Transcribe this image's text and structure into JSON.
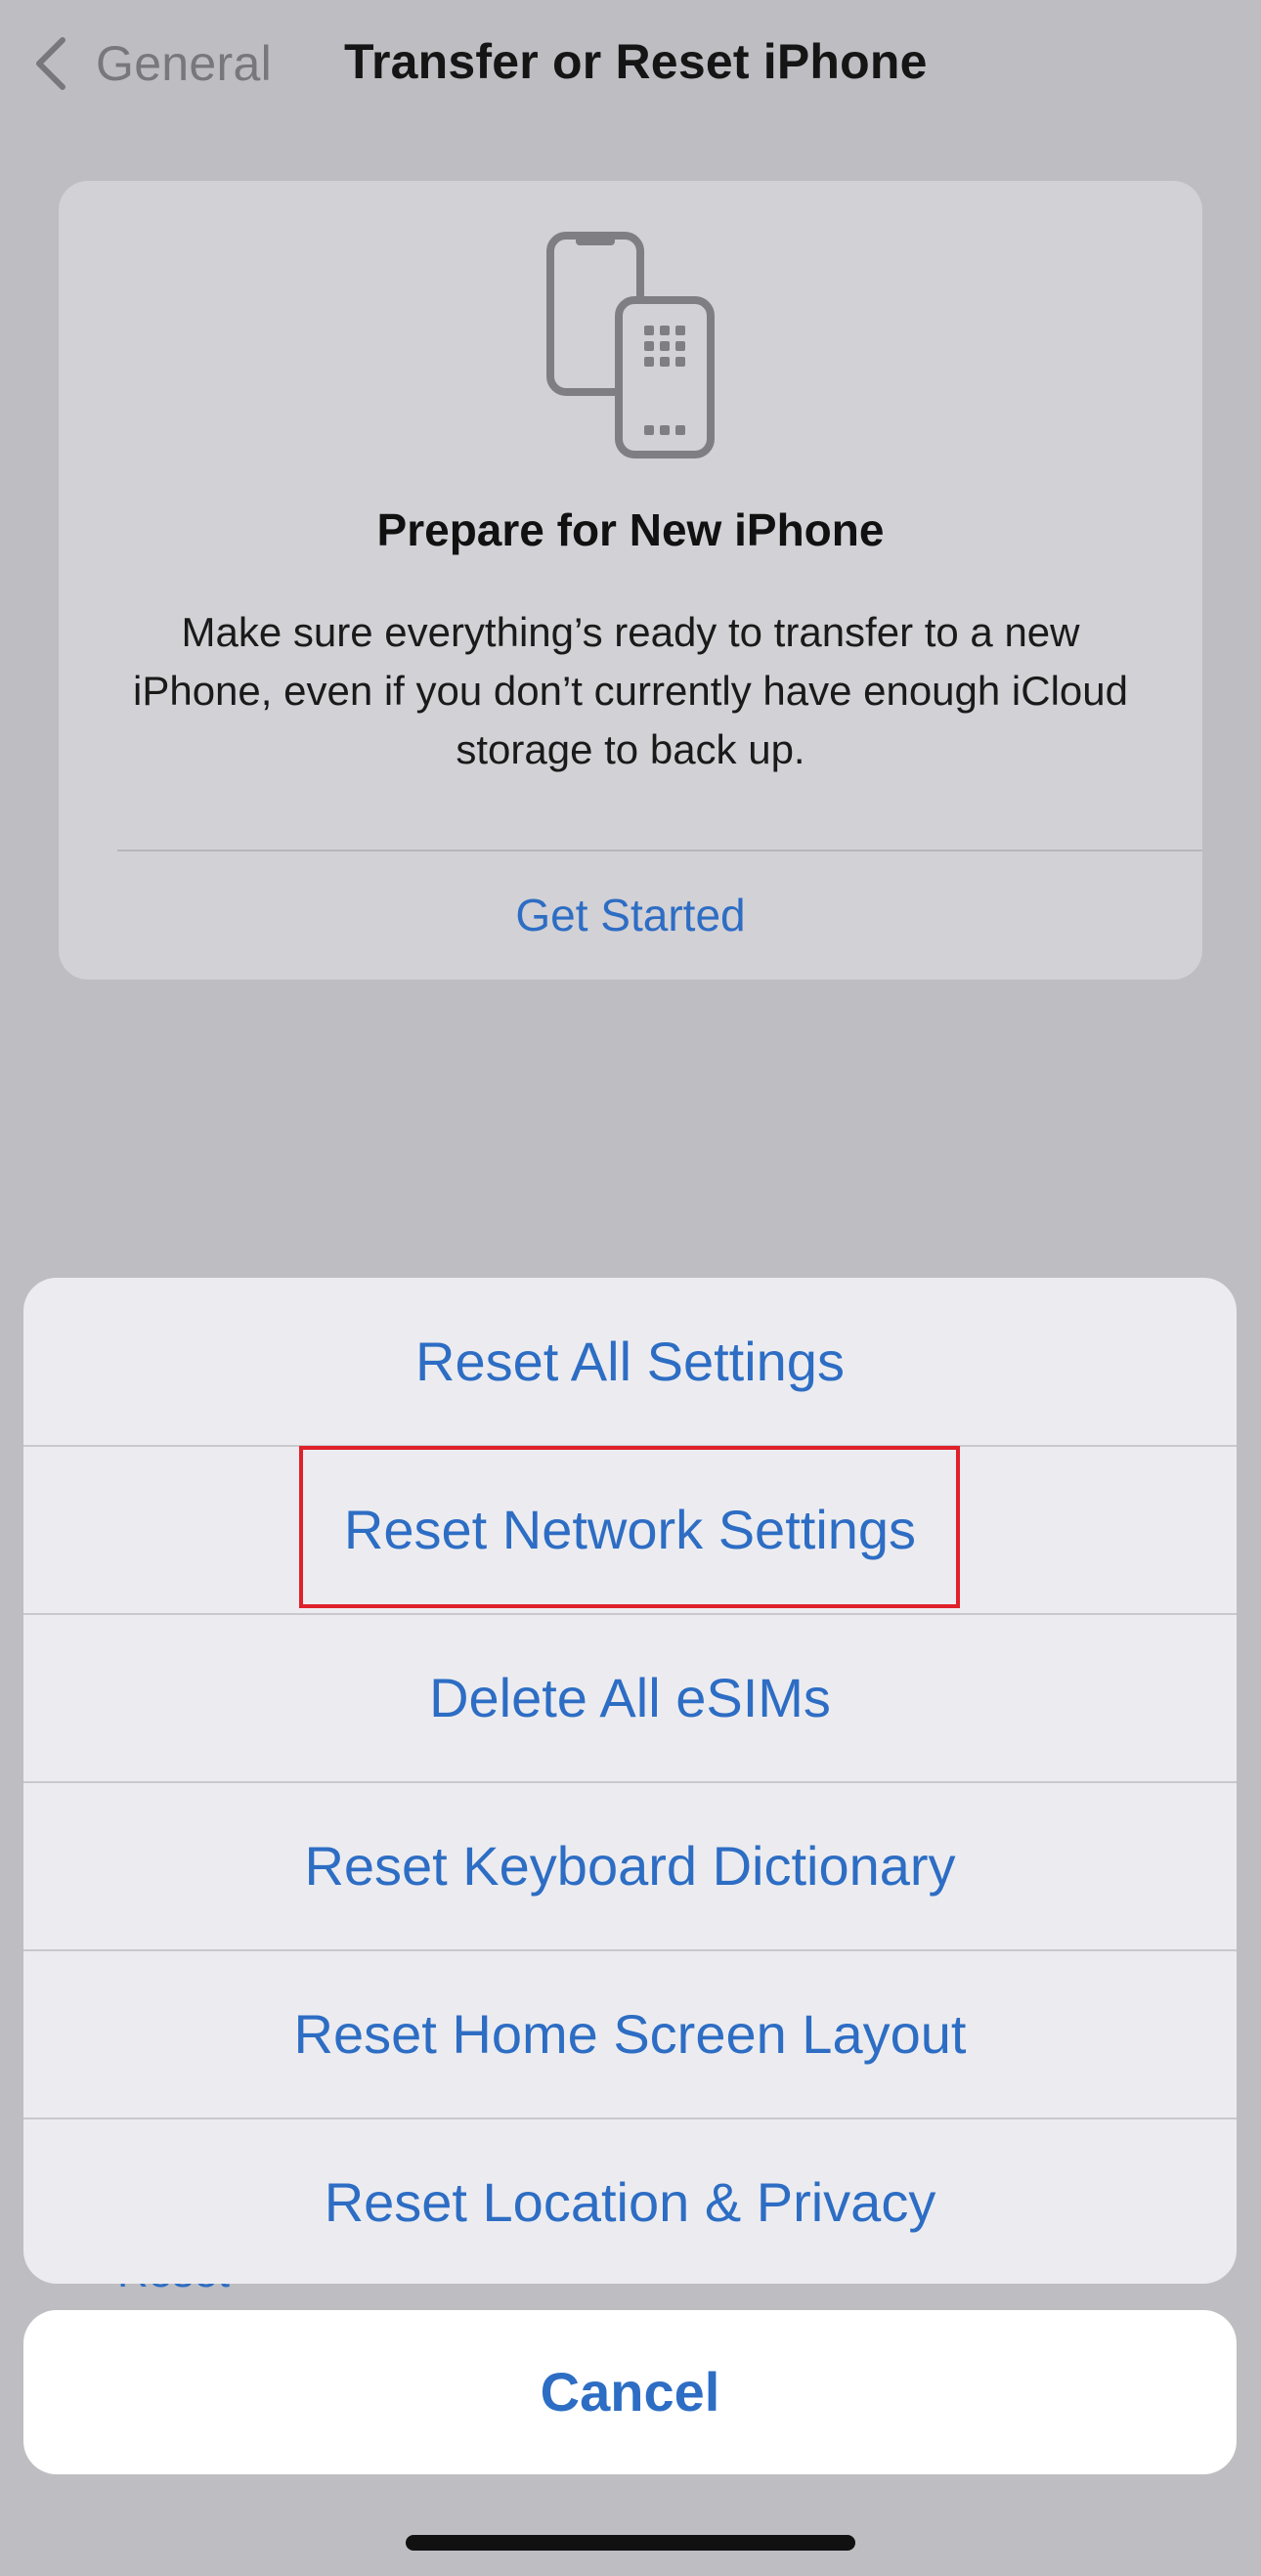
{
  "nav": {
    "back_label": "General",
    "title": "Transfer or Reset iPhone"
  },
  "prepare_card": {
    "icon": "two-phones-icon",
    "title": "Prepare for New iPhone",
    "description": "Make sure everything’s ready to transfer to a new iPhone, even if you don’t currently have enough iCloud storage to back up.",
    "link_label": "Get Started"
  },
  "background_list": {
    "reset_label": "Reset"
  },
  "action_sheet": {
    "items": [
      {
        "label": "Reset All Settings"
      },
      {
        "label": "Reset Network Settings",
        "highlighted": true
      },
      {
        "label": "Delete All eSIMs"
      },
      {
        "label": "Reset Keyboard Dictionary"
      },
      {
        "label": "Reset Home Screen Layout"
      },
      {
        "label": "Reset Location & Privacy"
      }
    ],
    "cancel_label": "Cancel"
  },
  "colors": {
    "accent": "#2d6dc4",
    "highlight_border": "#e0202a",
    "dimmed_background": "#bebdc2"
  }
}
